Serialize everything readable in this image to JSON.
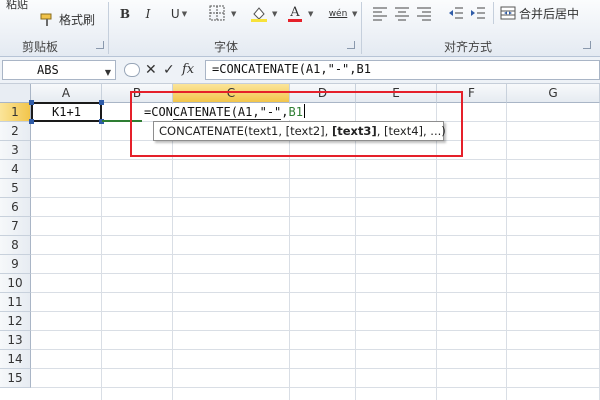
{
  "ribbon": {
    "paste_label": "粘贴",
    "format_painter_label": "格式刷",
    "clipboard_group": "剪贴板",
    "font_group": "字体",
    "alignment_group": "对齐方式",
    "bold_label": "B",
    "italic_label": "I",
    "underline_label": "U",
    "font_color_label": "A",
    "phonetic_label": "wén",
    "merge_center_label": "合并后居中"
  },
  "formula_bar": {
    "name_box": "ABS",
    "cancel_icon": "✕",
    "enter_icon": "✓",
    "fx_icon": "fx",
    "formula": "=CONCATENATE(A1,\"-\",B1"
  },
  "grid": {
    "columns": [
      "A",
      "B",
      "C",
      "D",
      "E",
      "F",
      "G"
    ],
    "active_column": "C",
    "rows": [
      "1",
      "2",
      "3",
      "4",
      "5",
      "6",
      "7",
      "8",
      "9",
      "10",
      "11",
      "12",
      "13",
      "14",
      "15"
    ],
    "active_row": "1",
    "cell_a1": "K1+1",
    "edit": {
      "prefix": "=CON",
      "underlined": "CATENATE(A1,\"-\"",
      "sep": ",",
      "ref": "B1"
    }
  },
  "tooltip": {
    "func": "CONCATENATE(",
    "args_before": "text1, [text2], ",
    "current_arg": "[text3]",
    "args_after": ", [text4], ...)"
  },
  "colors": {
    "highlight_box": "#e5202a",
    "active_header": "#f2c54b",
    "reference_green": "#2e7d32",
    "selection_blue": "#2f5ca8"
  }
}
